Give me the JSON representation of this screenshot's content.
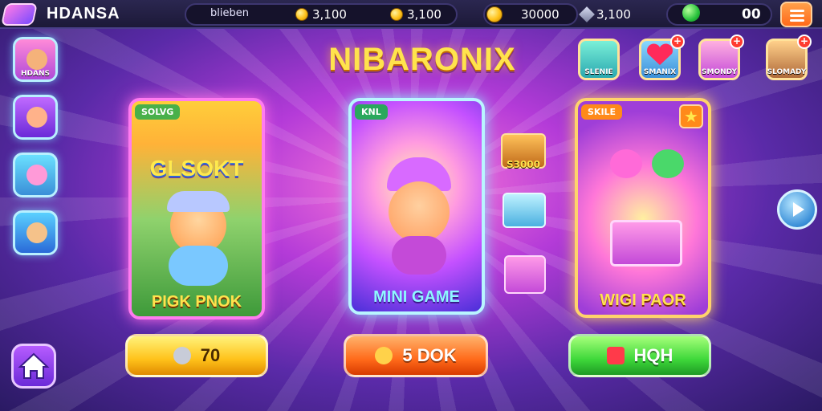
{
  "app": {
    "title": "HDANSA"
  },
  "topbar": {
    "user_label": "blieben",
    "currencies": [
      {
        "icon": "gold-coin-icon",
        "value": "3,100"
      },
      {
        "icon": "gold-coin-icon",
        "value": "3,100"
      },
      {
        "icon": "gold-coin-icon",
        "value": "30000"
      },
      {
        "icon": "silver-gem-icon",
        "value": "3,100"
      }
    ],
    "premium": {
      "icon": "green-gem-icon",
      "value": "00"
    },
    "menu_icon": "hamburger-menu-icon"
  },
  "game_title": "NIBARONIX",
  "sidebar": {
    "items": [
      {
        "label": "HDANS",
        "icon": "avatar-orange-hat-icon"
      },
      {
        "label": "",
        "icon": "avatar-pink-hat-icon"
      },
      {
        "label": "",
        "icon": "avatar-pink-cat-icon"
      },
      {
        "label": "",
        "icon": "avatar-green-leaf-icon"
      }
    ],
    "home_icon": "home-icon"
  },
  "shop": {
    "items": [
      {
        "label": "SLENIE",
        "icon": "purple-candy-icon",
        "badge": ""
      },
      {
        "label": "SMANIX",
        "icon": "heart-icon",
        "badge": "+"
      },
      {
        "label": "SMONDY",
        "icon": "pink-character-icon",
        "badge": "+"
      },
      {
        "label": "SLOMADY",
        "icon": "brown-character-icon",
        "badge": "+"
      }
    ]
  },
  "cards": [
    {
      "tag": "SOLVG",
      "wordart": "GLSOKT",
      "caption": "PIGK PNOK",
      "icon": "explorer-character-icon"
    },
    {
      "tag": "KNL",
      "wordart": "",
      "caption": "MINI GAME",
      "icon": "gnome-character-icon"
    },
    {
      "tag": "SKILE",
      "wordart": "",
      "caption": "WIGI PAOR",
      "icon": "treasure-chest-icon",
      "badge_icon": "star-icon"
    }
  ],
  "crates": [
    {
      "label": "S3000",
      "icon": "gold-crate-icon"
    },
    {
      "label": "",
      "icon": "ice-crate-icon"
    },
    {
      "label": "",
      "icon": "pink-crate-icon"
    }
  ],
  "actions": [
    {
      "label": "70",
      "icon": "silver-trophy-icon",
      "color": "#ffc21a"
    },
    {
      "label": "5 DOK",
      "icon": "golden-key-icon",
      "color": "#ff6a1a"
    },
    {
      "label": "HQH",
      "icon": "red-gem-icon",
      "color": "#3ed83a"
    }
  ],
  "nav": {
    "next_icon": "play-arrow-icon"
  },
  "colors": {
    "accent": "#ff7bf0",
    "gold": "#ffe34d",
    "background": "#b43bd8"
  }
}
